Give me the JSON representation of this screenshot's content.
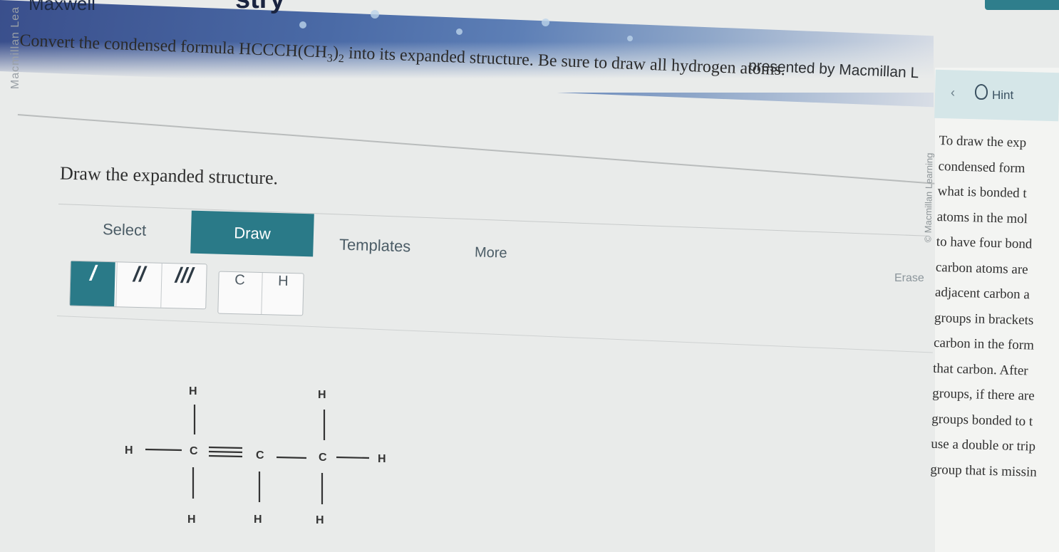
{
  "banner": {
    "author": "Maxwell",
    "brand_word": "stry",
    "side_brand": "Macmillan Lea",
    "presented_by": "presented by Macmillan L"
  },
  "question": {
    "prefix": "Convert the condensed formula HCCCH(CH",
    "sub1": "3",
    "mid": ")",
    "sub2": "2",
    "suffix": " into its expanded structure. Be sure to draw all hydrogen atoms."
  },
  "instruction": "Draw the expanded structure.",
  "toolbar": {
    "tabs": [
      "Select",
      "Draw",
      "Templates",
      "More"
    ],
    "active_tab": "Draw",
    "bond_tools": [
      "/",
      "//",
      "///"
    ],
    "atom_tools": [
      "C",
      "H"
    ],
    "erase_label": "Erase"
  },
  "hint": {
    "label": "Hint",
    "credit": "© Macmillan Learning",
    "lines": [
      "To draw the exp",
      "condensed form",
      "what is bonded t",
      "atoms in the mol",
      "to have four bond",
      "carbon atoms are",
      "adjacent carbon a",
      "groups in brackets",
      "carbon in the form",
      "that carbon. After",
      "groups, if there are",
      "groups bonded to t",
      "use a double or trip",
      "group that is missin"
    ]
  },
  "structure": {
    "atoms": {
      "h_left": "H",
      "c1": "C",
      "c2": "C",
      "c3": "C",
      "h_right": "H",
      "h_c1_top": "H",
      "h_c3_top": "H",
      "h_c1_bottom": "H",
      "h_c2_bottom": "H",
      "h_c3_bottom": "H"
    }
  },
  "colors": {
    "accent": "#2a7a88",
    "hint_bar": "#d5e6e8",
    "background": "#e9ebea"
  }
}
